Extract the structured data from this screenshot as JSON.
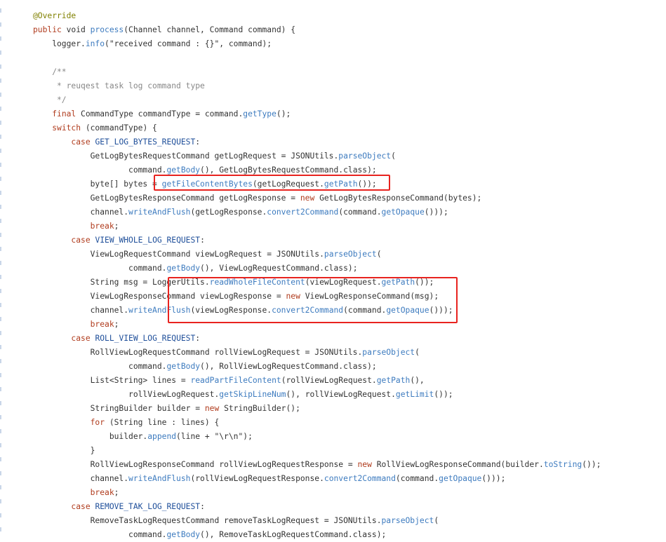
{
  "editor": {
    "colors": {
      "keyword": "#b03c1e",
      "method": "#3d7bbf",
      "annotation": "#808000",
      "comment": "#888888",
      "constant": "#1f4f9a",
      "text": "#333333",
      "highlight_box": "#e8231f"
    },
    "lines": [
      {
        "tokens": [
          {
            "t": "@Override",
            "c": "ann"
          }
        ]
      },
      {
        "tokens": [
          {
            "t": "public",
            "c": "kw"
          },
          {
            "t": " void ",
            "c": "plain"
          },
          {
            "t": "process",
            "c": "fn"
          },
          {
            "t": "(Channel channel, Command command) {",
            "c": "plain"
          }
        ]
      },
      {
        "tokens": [
          {
            "t": "    logger.",
            "c": "plain"
          },
          {
            "t": "info",
            "c": "fn"
          },
          {
            "t": "(\"received command : {}\", command);",
            "c": "plain"
          }
        ]
      },
      {
        "tokens": [
          {
            "t": "",
            "c": "plain"
          }
        ]
      },
      {
        "tokens": [
          {
            "t": "    /**",
            "c": "cm"
          }
        ]
      },
      {
        "tokens": [
          {
            "t": "     * reuqest task log command type",
            "c": "cm"
          }
        ]
      },
      {
        "tokens": [
          {
            "t": "     */",
            "c": "cm"
          }
        ]
      },
      {
        "tokens": [
          {
            "t": "    ",
            "c": "plain"
          },
          {
            "t": "final",
            "c": "kw"
          },
          {
            "t": " CommandType commandType = command.",
            "c": "plain"
          },
          {
            "t": "getType",
            "c": "fn"
          },
          {
            "t": "();",
            "c": "plain"
          }
        ]
      },
      {
        "tokens": [
          {
            "t": "    ",
            "c": "plain"
          },
          {
            "t": "switch",
            "c": "kw"
          },
          {
            "t": " (commandType) {",
            "c": "plain"
          }
        ]
      },
      {
        "tokens": [
          {
            "t": "        ",
            "c": "plain"
          },
          {
            "t": "case",
            "c": "kw"
          },
          {
            "t": " ",
            "c": "plain"
          },
          {
            "t": "GET_LOG_BYTES_REQUEST",
            "c": "const"
          },
          {
            "t": ":",
            "c": "plain"
          }
        ]
      },
      {
        "tokens": [
          {
            "t": "            GetLogBytesRequestCommand getLogRequest = JSONUtils.",
            "c": "plain"
          },
          {
            "t": "parseObject",
            "c": "fn"
          },
          {
            "t": "(",
            "c": "plain"
          }
        ]
      },
      {
        "tokens": [
          {
            "t": "                    command.",
            "c": "plain"
          },
          {
            "t": "getBody",
            "c": "fn"
          },
          {
            "t": "(), GetLogBytesRequestCommand.class);",
            "c": "plain"
          }
        ]
      },
      {
        "tokens": [
          {
            "t": "            byte[] bytes = ",
            "c": "plain"
          },
          {
            "t": "getFileContentBytes",
            "c": "fn"
          },
          {
            "t": "(getLogRequest.",
            "c": "plain"
          },
          {
            "t": "getPath",
            "c": "fn"
          },
          {
            "t": "());",
            "c": "plain"
          }
        ]
      },
      {
        "tokens": [
          {
            "t": "            GetLogBytesResponseCommand getLogResponse = ",
            "c": "plain"
          },
          {
            "t": "new",
            "c": "kw"
          },
          {
            "t": " GetLogBytesResponseCommand(bytes);",
            "c": "plain"
          }
        ]
      },
      {
        "tokens": [
          {
            "t": "            channel.",
            "c": "plain"
          },
          {
            "t": "writeAndFlush",
            "c": "fn"
          },
          {
            "t": "(getLogResponse.",
            "c": "plain"
          },
          {
            "t": "convert2Command",
            "c": "fn"
          },
          {
            "t": "(command.",
            "c": "plain"
          },
          {
            "t": "getOpaque",
            "c": "fn"
          },
          {
            "t": "()));",
            "c": "plain"
          }
        ]
      },
      {
        "tokens": [
          {
            "t": "            ",
            "c": "plain"
          },
          {
            "t": "break",
            "c": "kw"
          },
          {
            "t": ";",
            "c": "plain"
          }
        ]
      },
      {
        "tokens": [
          {
            "t": "        ",
            "c": "plain"
          },
          {
            "t": "case",
            "c": "kw"
          },
          {
            "t": " ",
            "c": "plain"
          },
          {
            "t": "VIEW_WHOLE_LOG_REQUEST",
            "c": "const"
          },
          {
            "t": ":",
            "c": "plain"
          }
        ]
      },
      {
        "tokens": [
          {
            "t": "            ViewLogRequestCommand viewLogRequest = JSONUtils.",
            "c": "plain"
          },
          {
            "t": "parseObject",
            "c": "fn"
          },
          {
            "t": "(",
            "c": "plain"
          }
        ]
      },
      {
        "tokens": [
          {
            "t": "                    command.",
            "c": "plain"
          },
          {
            "t": "getBody",
            "c": "fn"
          },
          {
            "t": "(), ViewLogRequestCommand.class);",
            "c": "plain"
          }
        ]
      },
      {
        "tokens": [
          {
            "t": "            String msg = LoggerUtils.",
            "c": "plain"
          },
          {
            "t": "readWholeFileContent",
            "c": "fn"
          },
          {
            "t": "(viewLogRequest.",
            "c": "plain"
          },
          {
            "t": "getPath",
            "c": "fn"
          },
          {
            "t": "());",
            "c": "plain"
          }
        ]
      },
      {
        "tokens": [
          {
            "t": "            ViewLogResponseCommand viewLogResponse = ",
            "c": "plain"
          },
          {
            "t": "new",
            "c": "kw"
          },
          {
            "t": " ViewLogResponseCommand(msg);",
            "c": "plain"
          }
        ]
      },
      {
        "tokens": [
          {
            "t": "            channel.",
            "c": "plain"
          },
          {
            "t": "writeAndFlush",
            "c": "fn"
          },
          {
            "t": "(viewLogResponse.",
            "c": "plain"
          },
          {
            "t": "convert2Command",
            "c": "fn"
          },
          {
            "t": "(command.",
            "c": "plain"
          },
          {
            "t": "getOpaque",
            "c": "fn"
          },
          {
            "t": "()));",
            "c": "plain"
          }
        ]
      },
      {
        "tokens": [
          {
            "t": "            ",
            "c": "plain"
          },
          {
            "t": "break",
            "c": "kw"
          },
          {
            "t": ";",
            "c": "plain"
          }
        ]
      },
      {
        "tokens": [
          {
            "t": "        ",
            "c": "plain"
          },
          {
            "t": "case",
            "c": "kw"
          },
          {
            "t": " ",
            "c": "plain"
          },
          {
            "t": "ROLL_VIEW_LOG_REQUEST",
            "c": "const"
          },
          {
            "t": ":",
            "c": "plain"
          }
        ]
      },
      {
        "tokens": [
          {
            "t": "            RollViewLogRequestCommand rollViewLogRequest = JSONUtils.",
            "c": "plain"
          },
          {
            "t": "parseObject",
            "c": "fn"
          },
          {
            "t": "(",
            "c": "plain"
          }
        ]
      },
      {
        "tokens": [
          {
            "t": "                    command.",
            "c": "plain"
          },
          {
            "t": "getBody",
            "c": "fn"
          },
          {
            "t": "(), RollViewLogRequestCommand.class);",
            "c": "plain"
          }
        ]
      },
      {
        "tokens": [
          {
            "t": "            List<String> lines = ",
            "c": "plain"
          },
          {
            "t": "readPartFileContent",
            "c": "fn"
          },
          {
            "t": "(rollViewLogRequest.",
            "c": "plain"
          },
          {
            "t": "getPath",
            "c": "fn"
          },
          {
            "t": "(),",
            "c": "plain"
          }
        ]
      },
      {
        "tokens": [
          {
            "t": "                    rollViewLogRequest.",
            "c": "plain"
          },
          {
            "t": "getSkipLineNum",
            "c": "fn"
          },
          {
            "t": "(), rollViewLogRequest.",
            "c": "plain"
          },
          {
            "t": "getLimit",
            "c": "fn"
          },
          {
            "t": "());",
            "c": "plain"
          }
        ]
      },
      {
        "tokens": [
          {
            "t": "            StringBuilder builder = ",
            "c": "plain"
          },
          {
            "t": "new",
            "c": "kw"
          },
          {
            "t": " StringBuilder();",
            "c": "plain"
          }
        ]
      },
      {
        "tokens": [
          {
            "t": "            ",
            "c": "plain"
          },
          {
            "t": "for",
            "c": "kw"
          },
          {
            "t": " (String line : lines) {",
            "c": "plain"
          }
        ]
      },
      {
        "tokens": [
          {
            "t": "                builder.",
            "c": "plain"
          },
          {
            "t": "append",
            "c": "fn"
          },
          {
            "t": "(line + \"\\r\\n\");",
            "c": "plain"
          }
        ]
      },
      {
        "tokens": [
          {
            "t": "            }",
            "c": "plain"
          }
        ]
      },
      {
        "tokens": [
          {
            "t": "            RollViewLogResponseCommand rollViewLogRequestResponse = ",
            "c": "plain"
          },
          {
            "t": "new",
            "c": "kw"
          },
          {
            "t": " RollViewLogResponseCommand(builder.",
            "c": "plain"
          },
          {
            "t": "toString",
            "c": "fn"
          },
          {
            "t": "());",
            "c": "plain"
          }
        ]
      },
      {
        "tokens": [
          {
            "t": "            channel.",
            "c": "plain"
          },
          {
            "t": "writeAndFlush",
            "c": "fn"
          },
          {
            "t": "(rollViewLogRequestResponse.",
            "c": "plain"
          },
          {
            "t": "convert2Command",
            "c": "fn"
          },
          {
            "t": "(command.",
            "c": "plain"
          },
          {
            "t": "getOpaque",
            "c": "fn"
          },
          {
            "t": "()));",
            "c": "plain"
          }
        ]
      },
      {
        "tokens": [
          {
            "t": "            ",
            "c": "plain"
          },
          {
            "t": "break",
            "c": "kw"
          },
          {
            "t": ";",
            "c": "plain"
          }
        ]
      },
      {
        "tokens": [
          {
            "t": "        ",
            "c": "plain"
          },
          {
            "t": "case",
            "c": "kw"
          },
          {
            "t": " ",
            "c": "plain"
          },
          {
            "t": "REMOVE_TAK_LOG_REQUEST",
            "c": "const"
          },
          {
            "t": ":",
            "c": "plain"
          }
        ]
      },
      {
        "tokens": [
          {
            "t": "            RemoveTaskLogRequestCommand removeTaskLogRequest = JSONUtils.",
            "c": "plain"
          },
          {
            "t": "parseObject",
            "c": "fn"
          },
          {
            "t": "(",
            "c": "plain"
          }
        ]
      },
      {
        "tokens": [
          {
            "t": "                    command.",
            "c": "plain"
          },
          {
            "t": "getBody",
            "c": "fn"
          },
          {
            "t": "(), RemoveTaskLogRequestCommand.class);",
            "c": "plain"
          }
        ]
      }
    ]
  }
}
